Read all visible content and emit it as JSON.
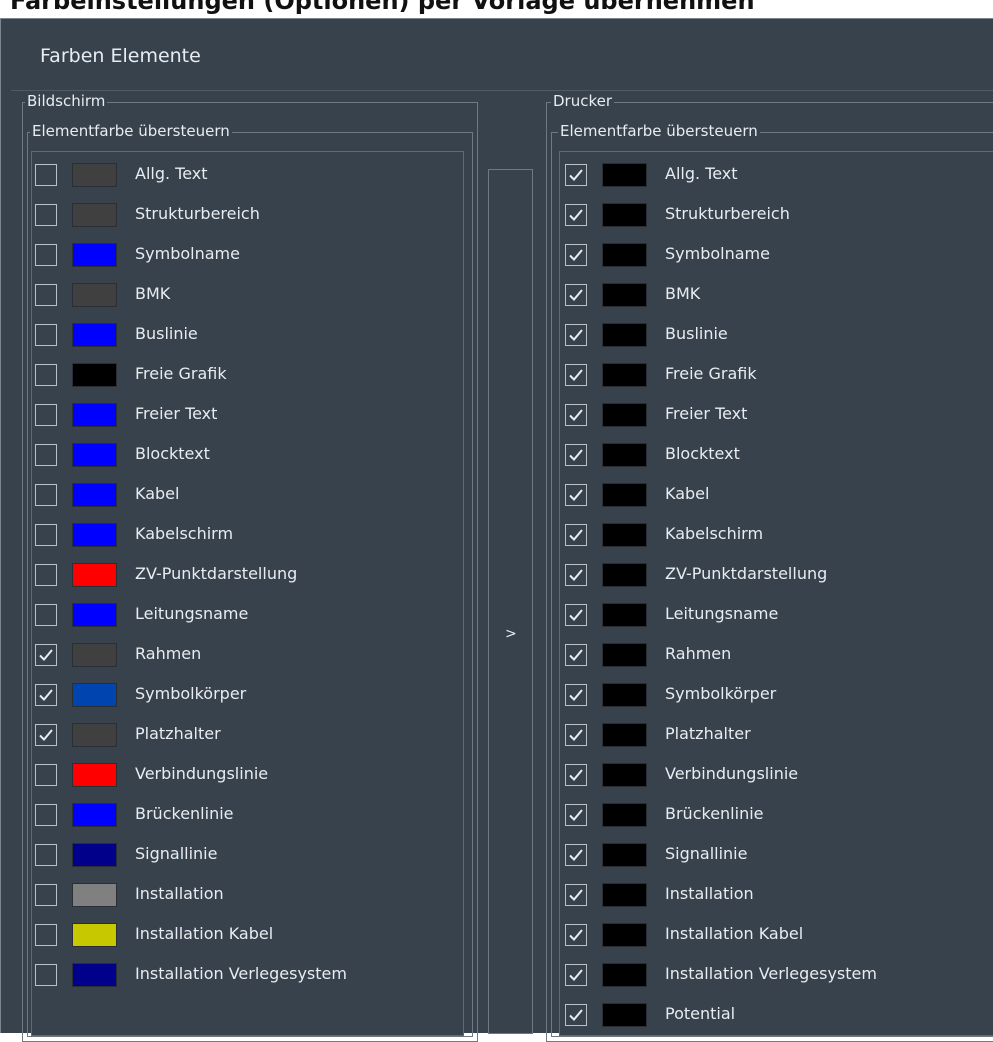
{
  "caption": "Farbeinstellungen (Optionen) per Vorlage übernehmen",
  "dialog": {
    "title": "Farben Elemente"
  },
  "screen": {
    "group_label": "Bildschirm",
    "override_label": "Elementfarbe übersteuern",
    "items": [
      {
        "label": "Allg. Text",
        "checked": false,
        "color": "#404040"
      },
      {
        "label": "Strukturbereich",
        "checked": false,
        "color": "#404040"
      },
      {
        "label": "Symbolname",
        "checked": false,
        "color": "#0000ff"
      },
      {
        "label": "BMK",
        "checked": false,
        "color": "#404040"
      },
      {
        "label": "Buslinie",
        "checked": false,
        "color": "#0000ff"
      },
      {
        "label": "Freie Grafik",
        "checked": false,
        "color": "#000000"
      },
      {
        "label": "Freier Text",
        "checked": false,
        "color": "#0000ff"
      },
      {
        "label": "Blocktext",
        "checked": false,
        "color": "#0000ff"
      },
      {
        "label": "Kabel",
        "checked": false,
        "color": "#0000ff"
      },
      {
        "label": "Kabelschirm",
        "checked": false,
        "color": "#0000ff"
      },
      {
        "label": "ZV-Punktdarstellung",
        "checked": false,
        "color": "#ff0000"
      },
      {
        "label": "Leitungsname",
        "checked": false,
        "color": "#0000ff"
      },
      {
        "label": "Rahmen",
        "checked": true,
        "color": "#404040"
      },
      {
        "label": "Symbolkörper",
        "checked": true,
        "color": "#0044b0"
      },
      {
        "label": "Platzhalter",
        "checked": true,
        "color": "#404040"
      },
      {
        "label": "Verbindungslinie",
        "checked": false,
        "color": "#ff0000"
      },
      {
        "label": "Brückenlinie",
        "checked": false,
        "color": "#0000ff"
      },
      {
        "label": "Signallinie",
        "checked": false,
        "color": "#00008b"
      },
      {
        "label": "Installation",
        "checked": false,
        "color": "#808080"
      },
      {
        "label": "Installation Kabel",
        "checked": false,
        "color": "#c8c800"
      },
      {
        "label": "Installation Verlegesystem",
        "checked": false,
        "color": "#00008b"
      }
    ]
  },
  "printer": {
    "group_label": "Drucker",
    "override_label": "Elementfarbe übersteuern",
    "items": [
      {
        "label": "Allg. Text",
        "checked": true,
        "color": "#000000"
      },
      {
        "label": "Strukturbereich",
        "checked": true,
        "color": "#000000"
      },
      {
        "label": "Symbolname",
        "checked": true,
        "color": "#000000"
      },
      {
        "label": "BMK",
        "checked": true,
        "color": "#000000"
      },
      {
        "label": "Buslinie",
        "checked": true,
        "color": "#000000"
      },
      {
        "label": "Freie Grafik",
        "checked": true,
        "color": "#000000"
      },
      {
        "label": "Freier Text",
        "checked": true,
        "color": "#000000"
      },
      {
        "label": "Blocktext",
        "checked": true,
        "color": "#000000"
      },
      {
        "label": "Kabel",
        "checked": true,
        "color": "#000000"
      },
      {
        "label": "Kabelschirm",
        "checked": true,
        "color": "#000000"
      },
      {
        "label": "ZV-Punktdarstellung",
        "checked": true,
        "color": "#000000"
      },
      {
        "label": "Leitungsname",
        "checked": true,
        "color": "#000000"
      },
      {
        "label": "Rahmen",
        "checked": true,
        "color": "#000000"
      },
      {
        "label": "Symbolkörper",
        "checked": true,
        "color": "#000000"
      },
      {
        "label": "Platzhalter",
        "checked": true,
        "color": "#000000"
      },
      {
        "label": "Verbindungslinie",
        "checked": true,
        "color": "#000000"
      },
      {
        "label": "Brückenlinie",
        "checked": true,
        "color": "#000000"
      },
      {
        "label": "Signallinie",
        "checked": true,
        "color": "#000000"
      },
      {
        "label": "Installation",
        "checked": true,
        "color": "#000000"
      },
      {
        "label": "Installation Kabel",
        "checked": true,
        "color": "#000000"
      },
      {
        "label": "Installation Verlegesystem",
        "checked": true,
        "color": "#000000"
      },
      {
        "label": "Potential",
        "checked": true,
        "color": "#000000"
      }
    ]
  },
  "copy_button_label": ">"
}
